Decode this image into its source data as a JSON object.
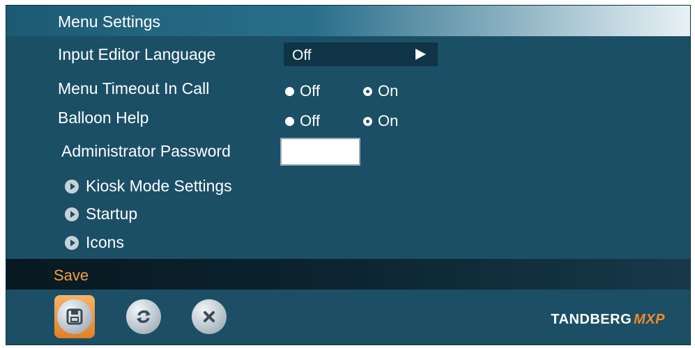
{
  "title": "Menu Settings",
  "settings": {
    "input_editor_language": {
      "label": "Input Editor Language",
      "value": "Off"
    },
    "menu_timeout": {
      "label": "Menu Timeout In Call",
      "off_label": "Off",
      "on_label": "On",
      "selected": "On"
    },
    "balloon_help": {
      "label": "Balloon Help",
      "off_label": "Off",
      "on_label": "On",
      "selected": "On"
    },
    "admin_password": {
      "label": "Administrator Password",
      "value": ""
    }
  },
  "submenus": [
    "Kiosk Mode Settings",
    "Startup",
    "Icons"
  ],
  "status": {
    "text": "Save"
  },
  "toolbar": {
    "buttons": [
      "save",
      "refresh",
      "cancel"
    ]
  },
  "logo": {
    "brand": "TANDBERG",
    "model": "MXP"
  },
  "colors": {
    "background": "#1b4f66",
    "accent": "#f08a2b",
    "status_text": "#f0a24a"
  }
}
